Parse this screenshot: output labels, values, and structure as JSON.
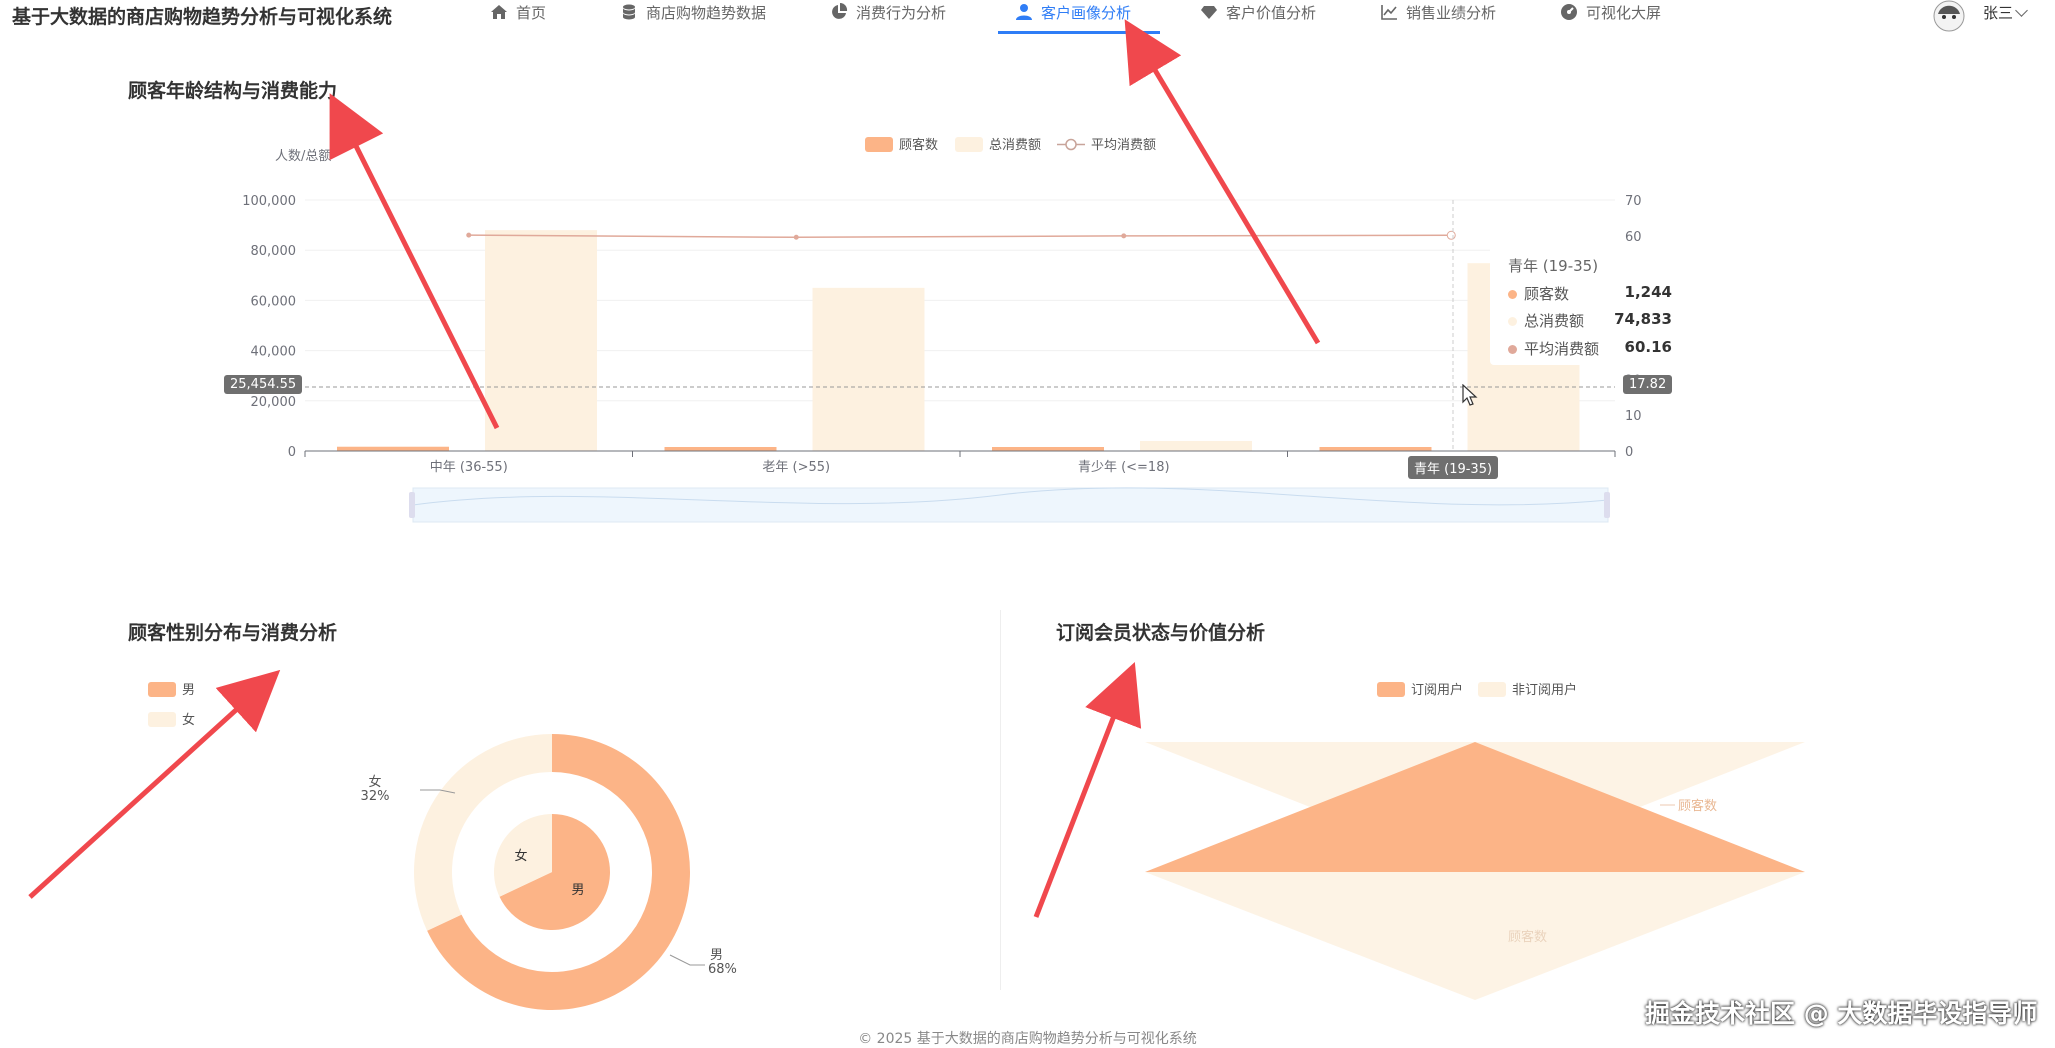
{
  "app": {
    "title": "基于大数据的商店购物趋势分析与可视化系统"
  },
  "nav": {
    "items": [
      {
        "label": "首页",
        "icon": "home-icon"
      },
      {
        "label": "商店购物趋势数据",
        "icon": "database-icon"
      },
      {
        "label": "消费行为分析",
        "icon": "pie-chart-icon"
      },
      {
        "label": "客户画像分析",
        "icon": "user-icon",
        "active": true
      },
      {
        "label": "客户价值分析",
        "icon": "diamond-icon"
      },
      {
        "label": "销售业绩分析",
        "icon": "line-chart-icon"
      },
      {
        "label": "可视化大屏",
        "icon": "dashboard-icon"
      }
    ]
  },
  "user": {
    "name": "张三"
  },
  "colors": {
    "accent": "#2f7df6",
    "orange": "#fcb487",
    "cream": "#fdf1e0",
    "line": "#e0a99a",
    "arrow": "#f0484d"
  },
  "age_section": {
    "title": "顾客年龄结构与消费能力",
    "y_left_label": "人数/总额",
    "left_ticks": [
      "100,000",
      "80,000",
      "60,000",
      "40,000",
      "20,000",
      "0"
    ],
    "right_ticks": [
      "70",
      "60",
      "20",
      "10",
      "0"
    ],
    "cursor_left_badge": "25,454.55",
    "cursor_right_badge": "17.82",
    "x_badge": "青年 (19-35)",
    "tooltip": {
      "title": "青年 (19-35)",
      "rows": [
        {
          "label": "顾客数",
          "value": "1,244"
        },
        {
          "label": "总消费额",
          "value": "74,833"
        },
        {
          "label": "平均消费额",
          "value": "60.16"
        }
      ]
    }
  },
  "gender_section": {
    "title": "顾客性别分布与消费分析",
    "legend": [
      "男",
      "女"
    ],
    "outer_labels": [
      {
        "name": "女",
        "pct": "32%"
      },
      {
        "name": "男",
        "pct": "68%"
      }
    ],
    "inner_labels": [
      "女",
      "男"
    ]
  },
  "member_section": {
    "title": "订阅会员状态与价值分析",
    "legend": [
      "订阅用户",
      "非订阅用户"
    ],
    "labels": [
      "顾客数",
      "顾客数"
    ]
  },
  "chart_data": [
    {
      "type": "bar",
      "title": "顾客年龄结构与消费能力",
      "ylabel": "人数/总额",
      "categories": [
        "中年 (36-55)",
        "老年 (>55)",
        "青少年 (<=18)",
        "青年 (19-35)"
      ],
      "ylim": [
        0,
        100000
      ],
      "y2lim": [
        0,
        70
      ],
      "legend_position": "top",
      "series": [
        {
          "name": "顾客数",
          "type": "bar",
          "values": [
            1700,
            1150,
            60,
            1244
          ],
          "color": "#fcb487"
        },
        {
          "name": "总消费额",
          "type": "bar",
          "values": [
            88000,
            65000,
            4000,
            74833
          ],
          "color": "#fdf1e0"
        },
        {
          "name": "平均消费额",
          "type": "line",
          "axis": "right",
          "values": [
            60.2,
            59.6,
            60.0,
            60.16
          ],
          "color": "#e0a99a"
        }
      ]
    },
    {
      "type": "pie",
      "title": "顾客性别分布与消费分析",
      "legend_position": "top-left",
      "series": [
        {
          "name": "outer",
          "labels": [
            "男",
            "女"
          ],
          "values": [
            68,
            32
          ],
          "colors": [
            "#fcb487",
            "#fdf1e0"
          ]
        },
        {
          "name": "inner",
          "labels": [
            "男",
            "女"
          ],
          "values": [
            68,
            32
          ],
          "colors": [
            "#fcb487",
            "#fdf1e0"
          ]
        }
      ]
    },
    {
      "type": "funnel",
      "title": "订阅会员状态与价值分析",
      "legend_position": "top",
      "series": [
        {
          "name": "订阅用户",
          "labels": [
            "顾客数"
          ],
          "color": "#fcb487"
        },
        {
          "name": "非订阅用户",
          "labels": [
            "顾客数"
          ],
          "color": "#fdf1e0"
        }
      ]
    }
  ],
  "footer": {
    "text": "© 2025 基于大数据的商店购物趋势分析与可视化系统"
  },
  "watermark": {
    "text": "掘金技术社区 @ 大数据毕设指导师"
  }
}
